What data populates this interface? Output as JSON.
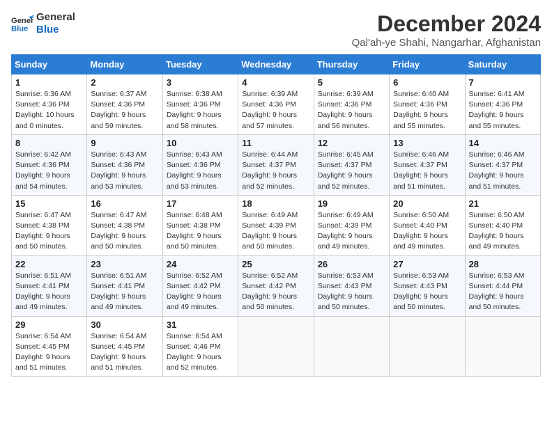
{
  "logo": {
    "line1": "General",
    "line2": "Blue"
  },
  "title": "December 2024",
  "subtitle": "Qal'ah-ye Shahi, Nangarhar, Afghanistan",
  "header_days": [
    "Sunday",
    "Monday",
    "Tuesday",
    "Wednesday",
    "Thursday",
    "Friday",
    "Saturday"
  ],
  "weeks": [
    [
      {
        "day": "1",
        "info": "Sunrise: 6:36 AM\nSunset: 4:36 PM\nDaylight: 10 hours\nand 0 minutes."
      },
      {
        "day": "2",
        "info": "Sunrise: 6:37 AM\nSunset: 4:36 PM\nDaylight: 9 hours\nand 59 minutes."
      },
      {
        "day": "3",
        "info": "Sunrise: 6:38 AM\nSunset: 4:36 PM\nDaylight: 9 hours\nand 58 minutes."
      },
      {
        "day": "4",
        "info": "Sunrise: 6:39 AM\nSunset: 4:36 PM\nDaylight: 9 hours\nand 57 minutes."
      },
      {
        "day": "5",
        "info": "Sunrise: 6:39 AM\nSunset: 4:36 PM\nDaylight: 9 hours\nand 56 minutes."
      },
      {
        "day": "6",
        "info": "Sunrise: 6:40 AM\nSunset: 4:36 PM\nDaylight: 9 hours\nand 55 minutes."
      },
      {
        "day": "7",
        "info": "Sunrise: 6:41 AM\nSunset: 4:36 PM\nDaylight: 9 hours\nand 55 minutes."
      }
    ],
    [
      {
        "day": "8",
        "info": "Sunrise: 6:42 AM\nSunset: 4:36 PM\nDaylight: 9 hours\nand 54 minutes."
      },
      {
        "day": "9",
        "info": "Sunrise: 6:43 AM\nSunset: 4:36 PM\nDaylight: 9 hours\nand 53 minutes."
      },
      {
        "day": "10",
        "info": "Sunrise: 6:43 AM\nSunset: 4:36 PM\nDaylight: 9 hours\nand 53 minutes."
      },
      {
        "day": "11",
        "info": "Sunrise: 6:44 AM\nSunset: 4:37 PM\nDaylight: 9 hours\nand 52 minutes."
      },
      {
        "day": "12",
        "info": "Sunrise: 6:45 AM\nSunset: 4:37 PM\nDaylight: 9 hours\nand 52 minutes."
      },
      {
        "day": "13",
        "info": "Sunrise: 6:46 AM\nSunset: 4:37 PM\nDaylight: 9 hours\nand 51 minutes."
      },
      {
        "day": "14",
        "info": "Sunrise: 6:46 AM\nSunset: 4:37 PM\nDaylight: 9 hours\nand 51 minutes."
      }
    ],
    [
      {
        "day": "15",
        "info": "Sunrise: 6:47 AM\nSunset: 4:38 PM\nDaylight: 9 hours\nand 50 minutes."
      },
      {
        "day": "16",
        "info": "Sunrise: 6:47 AM\nSunset: 4:38 PM\nDaylight: 9 hours\nand 50 minutes."
      },
      {
        "day": "17",
        "info": "Sunrise: 6:48 AM\nSunset: 4:38 PM\nDaylight: 9 hours\nand 50 minutes."
      },
      {
        "day": "18",
        "info": "Sunrise: 6:49 AM\nSunset: 4:39 PM\nDaylight: 9 hours\nand 50 minutes."
      },
      {
        "day": "19",
        "info": "Sunrise: 6:49 AM\nSunset: 4:39 PM\nDaylight: 9 hours\nand 49 minutes."
      },
      {
        "day": "20",
        "info": "Sunrise: 6:50 AM\nSunset: 4:40 PM\nDaylight: 9 hours\nand 49 minutes."
      },
      {
        "day": "21",
        "info": "Sunrise: 6:50 AM\nSunset: 4:40 PM\nDaylight: 9 hours\nand 49 minutes."
      }
    ],
    [
      {
        "day": "22",
        "info": "Sunrise: 6:51 AM\nSunset: 4:41 PM\nDaylight: 9 hours\nand 49 minutes."
      },
      {
        "day": "23",
        "info": "Sunrise: 6:51 AM\nSunset: 4:41 PM\nDaylight: 9 hours\nand 49 minutes."
      },
      {
        "day": "24",
        "info": "Sunrise: 6:52 AM\nSunset: 4:42 PM\nDaylight: 9 hours\nand 49 minutes."
      },
      {
        "day": "25",
        "info": "Sunrise: 6:52 AM\nSunset: 4:42 PM\nDaylight: 9 hours\nand 50 minutes."
      },
      {
        "day": "26",
        "info": "Sunrise: 6:53 AM\nSunset: 4:43 PM\nDaylight: 9 hours\nand 50 minutes."
      },
      {
        "day": "27",
        "info": "Sunrise: 6:53 AM\nSunset: 4:43 PM\nDaylight: 9 hours\nand 50 minutes."
      },
      {
        "day": "28",
        "info": "Sunrise: 6:53 AM\nSunset: 4:44 PM\nDaylight: 9 hours\nand 50 minutes."
      }
    ],
    [
      {
        "day": "29",
        "info": "Sunrise: 6:54 AM\nSunset: 4:45 PM\nDaylight: 9 hours\nand 51 minutes."
      },
      {
        "day": "30",
        "info": "Sunrise: 6:54 AM\nSunset: 4:45 PM\nDaylight: 9 hours\nand 51 minutes."
      },
      {
        "day": "31",
        "info": "Sunrise: 6:54 AM\nSunset: 4:46 PM\nDaylight: 9 hours\nand 52 minutes."
      },
      null,
      null,
      null,
      null
    ]
  ]
}
